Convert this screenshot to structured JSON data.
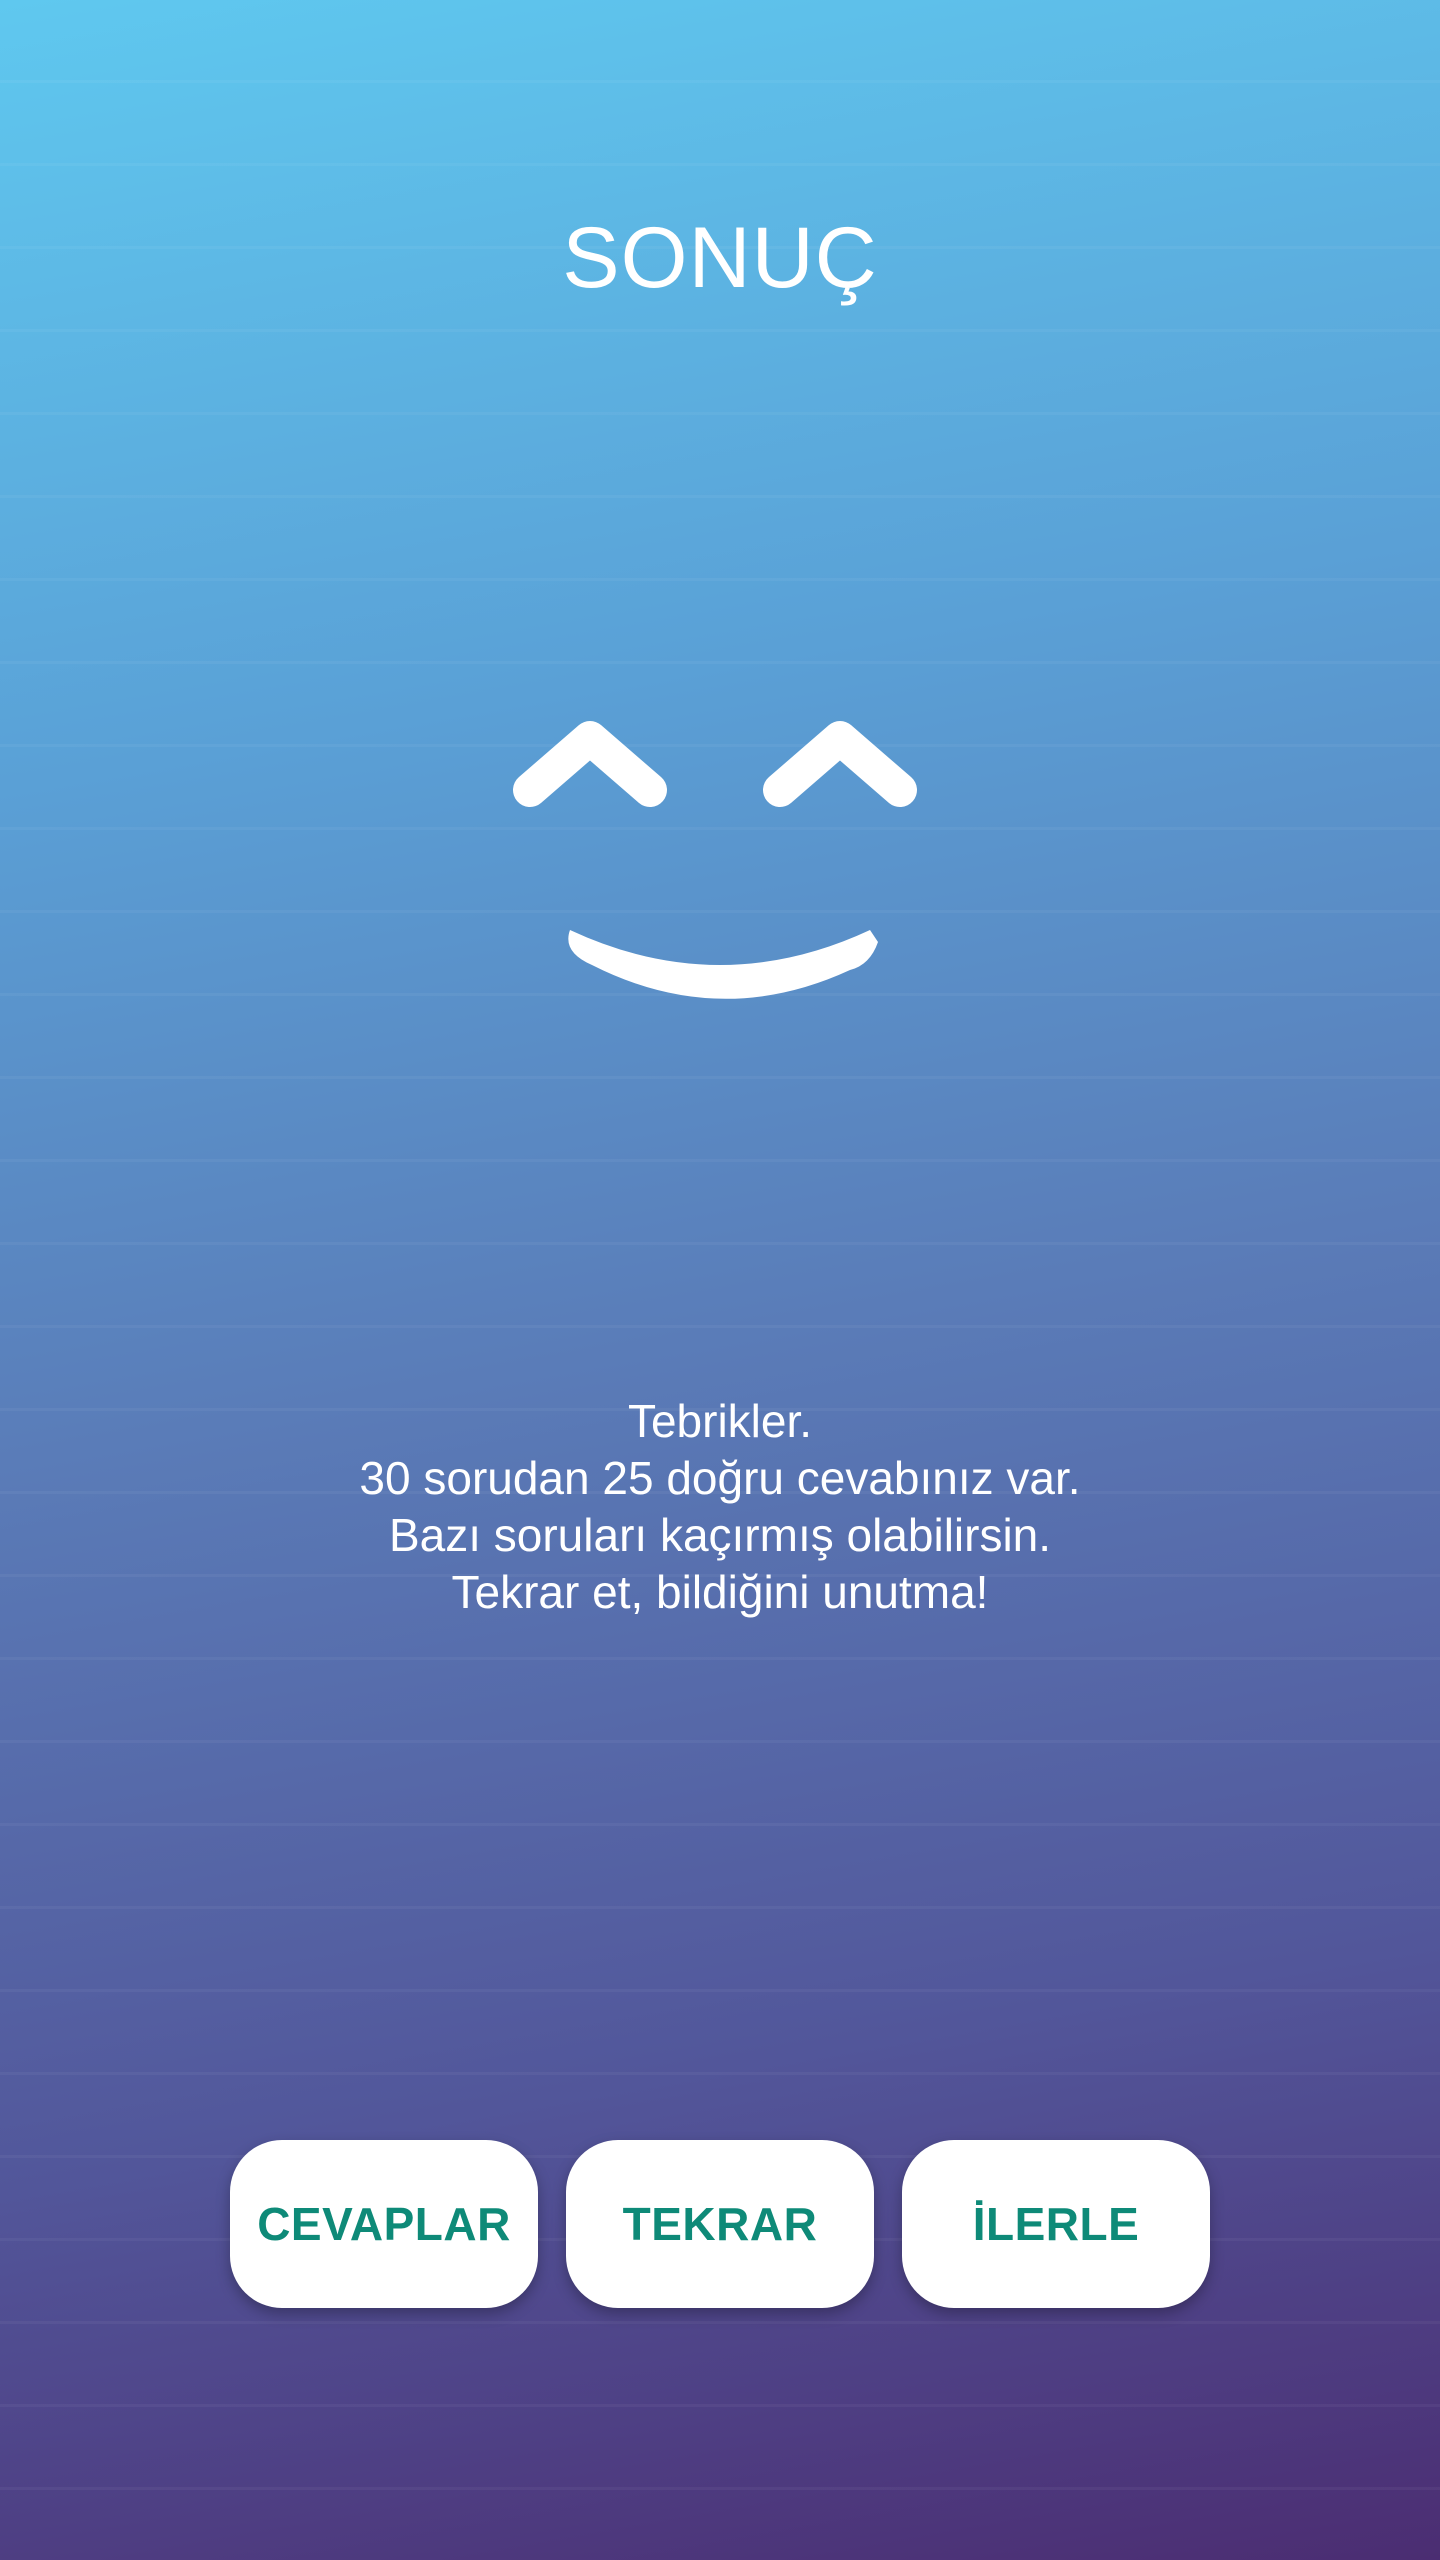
{
  "screen": {
    "title": "SONUÇ"
  },
  "face_icon": "smiling-face-icon",
  "message": {
    "line1": "Tebrikler.",
    "line2": "30 sorudan 25 doğru cevabınız var.",
    "line3": "Bazı soruları kaçırmış olabilirsin.",
    "line4": "Tekrar et, bildiğini unutma!"
  },
  "score": {
    "total_questions": 30,
    "correct_answers": 25
  },
  "buttons": {
    "answers_label": "CEVAPLAR",
    "retry_label": "TEKRAR",
    "next_label": "İLERLE"
  },
  "colors": {
    "gradient_top": "#5fc8ef",
    "gradient_bottom": "#4b2d72",
    "button_text": "#0e8a78",
    "button_bg": "#ffffff"
  }
}
